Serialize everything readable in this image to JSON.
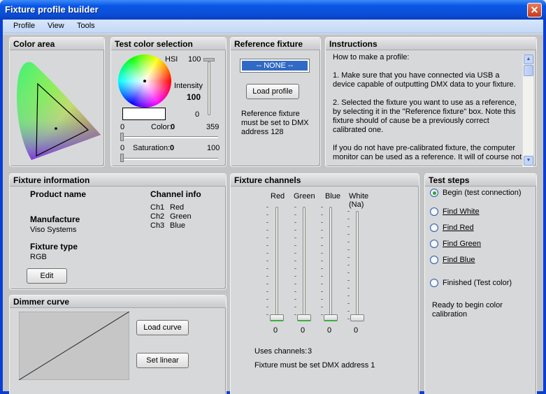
{
  "window": {
    "title": "Fixture profile builder",
    "close_glyph": "✕"
  },
  "menu": {
    "items": [
      "Profile",
      "View",
      "Tools"
    ]
  },
  "color_area": {
    "title": "Color area"
  },
  "test_color": {
    "title": "Test color selection",
    "hsi_label": "HSI",
    "intensity_max": "100",
    "intensity_label": "Intensity",
    "intensity_value": "100",
    "intensity_min": "0",
    "color_min": "0",
    "color_label": "Color:",
    "color_value": "0",
    "color_max": "359",
    "saturation_min": "0",
    "saturation_label": "Saturation:",
    "saturation_value": "0",
    "saturation_max": "100"
  },
  "reference": {
    "title": "Reference fixture",
    "selected": "-- NONE --",
    "load_button": "Load profile",
    "note_lines": [
      "Reference fixture",
      "must be set to DMX",
      "address 128"
    ]
  },
  "instructions": {
    "title": "Instructions",
    "lines": [
      "How to make a profile:",
      "",
      "1. Make sure that you have connected via USB a",
      "device capable of outputting DMX data to your fixture.",
      "",
      "2. Selected the fixture you want to use as a reference,",
      "by selecting it in the \"Reference fixture\" box. Note this",
      "fixture should of cause be a previously correct",
      "calibrated one.",
      "",
      "If you do not have pre-calibrated fixture, the computer",
      "monitor can be used as a reference. It will of course not"
    ]
  },
  "fixture_info": {
    "title": "Fixture information",
    "product_name_label": "Product name",
    "manufacture_label": "Manufacture",
    "manufacture_value": "Viso Systems",
    "fixture_type_label": "Fixture type",
    "fixture_type_value": "RGB",
    "channel_info_label": "Channel info",
    "channels": [
      {
        "id": "Ch1",
        "name": "Red"
      },
      {
        "id": "Ch2",
        "name": "Green"
      },
      {
        "id": "Ch3",
        "name": "Blue"
      }
    ],
    "edit_button": "Edit"
  },
  "dimmer": {
    "title": "Dimmer curve",
    "load_button": "Load curve",
    "linear_button": "Set linear"
  },
  "channels": {
    "title": "Fixture channels",
    "faders": [
      {
        "label": "Red",
        "value": "0"
      },
      {
        "label": "Green",
        "value": "0"
      },
      {
        "label": "Blue",
        "value": "0"
      },
      {
        "label": "White\n(Na)",
        "value": "0"
      }
    ],
    "uses_label": "Uses channels:",
    "uses_value": "3",
    "address_note": "Fixture must be set DMX address 1"
  },
  "steps": {
    "title": "Test steps",
    "items": [
      {
        "label": "Begin (test connection)",
        "selected": true,
        "link": false
      },
      {
        "label": "Find White",
        "selected": false,
        "link": true
      },
      {
        "label": "Find Red",
        "selected": false,
        "link": true
      },
      {
        "label": "Find Green",
        "selected": false,
        "link": true
      },
      {
        "label": "Find Blue",
        "selected": false,
        "link": true
      },
      {
        "label": "Finished (Test color)",
        "selected": false,
        "link": false
      }
    ],
    "status_lines": [
      "Ready to begin color",
      "calibration"
    ]
  }
}
